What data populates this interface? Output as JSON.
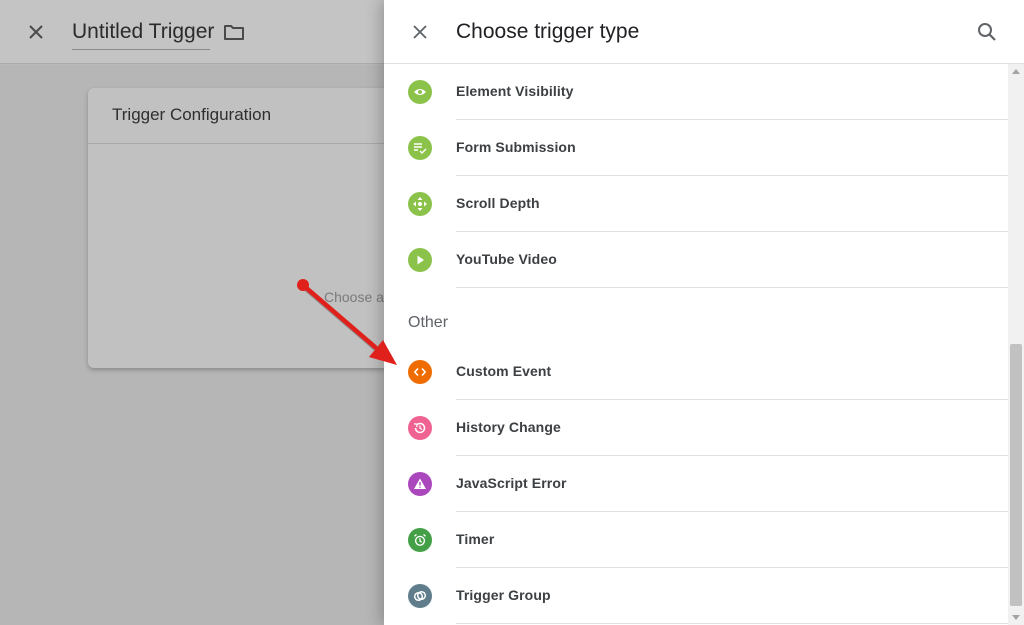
{
  "editor": {
    "title": "Untitled Trigger",
    "card_title": "Trigger Configuration",
    "card_hint": "Choose a"
  },
  "panel": {
    "title": "Choose trigger type",
    "section_other": "Other",
    "items": [
      {
        "label": "Element Visibility",
        "icon": "eye-icon",
        "color": "#8bc34a"
      },
      {
        "label": "Form Submission",
        "icon": "form-check-icon",
        "color": "#8bc34a"
      },
      {
        "label": "Scroll Depth",
        "icon": "scroll-arrows-icon",
        "color": "#8bc34a"
      },
      {
        "label": "YouTube Video",
        "icon": "play-icon",
        "color": "#8bc34a"
      },
      {
        "label": "Custom Event",
        "icon": "code-icon",
        "color": "#ef6c00"
      },
      {
        "label": "History Change",
        "icon": "history-icon",
        "color": "#f06292"
      },
      {
        "label": "JavaScript Error",
        "icon": "warning-icon",
        "color": "#ab47bc"
      },
      {
        "label": "Timer",
        "icon": "alarm-clock-icon",
        "color": "#43a047"
      },
      {
        "label": "Trigger Group",
        "icon": "group-circles-icon",
        "color": "#607d8b"
      }
    ]
  },
  "annotation": {
    "color": "#e0201b"
  }
}
